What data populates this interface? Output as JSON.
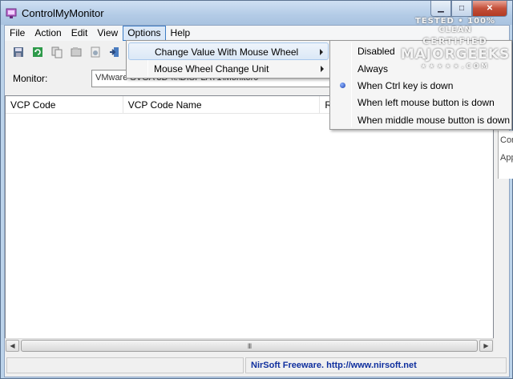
{
  "window": {
    "title": "ControlMyMonitor"
  },
  "menubar": {
    "items": [
      "File",
      "Action",
      "Edit",
      "View",
      "Options",
      "Help"
    ],
    "active": "Options"
  },
  "monitor": {
    "label": "Monitor:",
    "selected": "VMware SVGA 3D     \\\\.\\DISPLAY1\\Monitor0"
  },
  "table": {
    "columns": [
      "VCP Code",
      "VCP Code Name",
      "R"
    ]
  },
  "hscroll": {
    "grip": "III"
  },
  "status": {
    "left": "",
    "right": "NirSoft Freeware.  http://www.nirsoft.net"
  },
  "options_menu": {
    "items": [
      {
        "label": "Change Value With Mouse Wheel",
        "submenu": true,
        "highlighted": true
      },
      {
        "label": "Mouse Wheel Change Unit",
        "submenu": true,
        "highlighted": false
      }
    ]
  },
  "wheel_submenu": {
    "items": [
      "Disabled",
      "Always",
      "When Ctrl key is down",
      "When left mouse button is down",
      "When middle mouse button is down"
    ],
    "checked": "When Ctrl key is down"
  },
  "behind_window": {
    "lines": [
      "Con",
      "App"
    ]
  },
  "watermark": {
    "line1": "TESTED • 100% CLEAN",
    "line2": "CERTIFIED",
    "line3": "MAJORGEEKS",
    "line4": "★★★★★.COM"
  },
  "colors": {
    "accent": "#3d7dc6",
    "status_link": "#0f2f9e",
    "titlebar": "#b3cbe6",
    "close_button": "#c4503a"
  },
  "icons": [
    "app-icon",
    "save-icon",
    "refresh-icon",
    "copy-icon",
    "properties-icon",
    "html-report-icon",
    "exit-icon"
  ]
}
